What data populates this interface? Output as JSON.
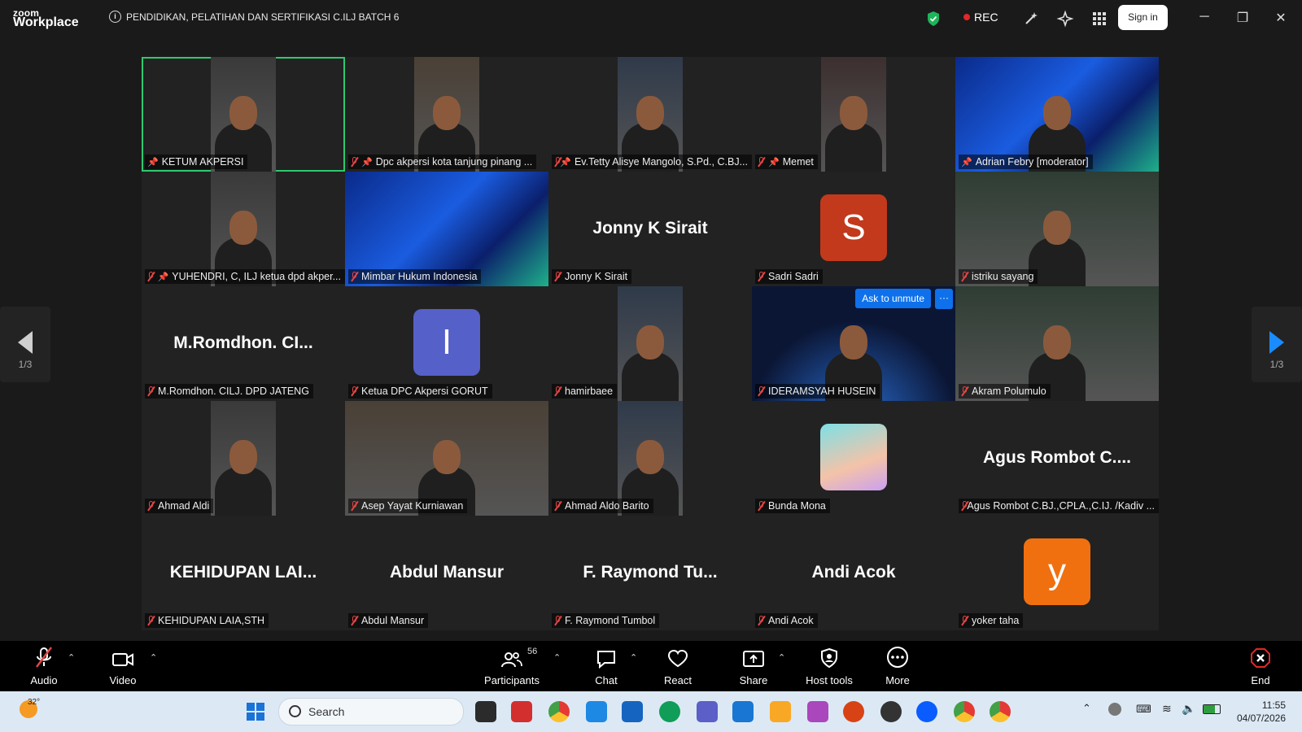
{
  "app": {
    "brand_top": "zoom",
    "brand_bottom": "Workplace",
    "meeting_title": "PENDIDIKAN, PELATIHAN DAN SERTIFIKASI C.ILJ BATCH 6",
    "rec_label": "REC",
    "sign_in": "Sign in"
  },
  "grid": {
    "tiles": [
      {
        "name": "KETUM AKPERSI",
        "muted": false,
        "pinned": true,
        "kind": "video",
        "active": true
      },
      {
        "name": "Dpc akpersi kota tanjung pinang ...",
        "muted": true,
        "pinned": true,
        "kind": "video"
      },
      {
        "name": "Ev.Tetty Alisye Mangolo, S.Pd., C.BJ...",
        "muted": true,
        "pinned": true,
        "kind": "video"
      },
      {
        "name": "Memet",
        "muted": true,
        "pinned": true,
        "kind": "video"
      },
      {
        "name": "Adrian Febry [moderator]",
        "muted": false,
        "pinned": true,
        "kind": "video-wide"
      },
      {
        "name": "YUHENDRI, C, ILJ ketua dpd akper...",
        "muted": true,
        "pinned": true,
        "kind": "video"
      },
      {
        "name": "Mimbar Hukum Indonesia",
        "muted": true,
        "pinned": false,
        "kind": "video-wide"
      },
      {
        "name": "Jonny K Sirait",
        "muted": true,
        "pinned": false,
        "kind": "text",
        "big": "Jonny K Sirait"
      },
      {
        "name": "Sadri Sadri",
        "muted": true,
        "pinned": false,
        "kind": "avatar",
        "letter": "S",
        "color": "#c2391b"
      },
      {
        "name": "istriku sayang",
        "muted": true,
        "pinned": false,
        "kind": "video-wide"
      },
      {
        "name": "M.Romdhon. CILJ. DPD JATENG",
        "muted": true,
        "pinned": false,
        "kind": "text",
        "big": "M.Romdhon. CI..."
      },
      {
        "name": "Ketua DPC Akpersi GORUT",
        "muted": true,
        "pinned": false,
        "kind": "avatar",
        "letter": "I",
        "color": "#5660c9"
      },
      {
        "name": "hamirbaee",
        "muted": true,
        "pinned": false,
        "kind": "video"
      },
      {
        "name": "IDERAMSYAH HUSEIN",
        "muted": true,
        "pinned": false,
        "kind": "video-wide",
        "ask_unmute": "Ask to unmute"
      },
      {
        "name": "Akram Polumulo",
        "muted": true,
        "pinned": false,
        "kind": "video-wide"
      },
      {
        "name": "Ahmad Aldi",
        "muted": true,
        "pinned": false,
        "kind": "video"
      },
      {
        "name": "Asep Yayat Kurniawan",
        "muted": true,
        "pinned": false,
        "kind": "video-wide"
      },
      {
        "name": "Ahmad Aldo Barito",
        "muted": true,
        "pinned": false,
        "kind": "video"
      },
      {
        "name": "Bunda Mona",
        "muted": true,
        "pinned": false,
        "kind": "photo"
      },
      {
        "name": "Agus Rombot C.BJ.,CPLA.,C.IJ. /Kadiv ...",
        "muted": true,
        "pinned": false,
        "kind": "text",
        "big": "Agus  Rombot  C...."
      },
      {
        "name": "KEHIDUPAN LAIA,STH",
        "muted": true,
        "pinned": false,
        "kind": "text",
        "big": "KEHIDUPAN  LAI..."
      },
      {
        "name": "Abdul Mansur",
        "muted": true,
        "pinned": false,
        "kind": "text",
        "big": "Abdul Mansur"
      },
      {
        "name": "F. Raymond Tumbol",
        "muted": true,
        "pinned": false,
        "kind": "text",
        "big": "F.  Raymond  Tu..."
      },
      {
        "name": "Andi Acok",
        "muted": true,
        "pinned": false,
        "kind": "text",
        "big": "Andi Acok"
      },
      {
        "name": "yoker taha",
        "muted": true,
        "pinned": false,
        "kind": "avatar",
        "letter": "y",
        "color": "#f07010"
      }
    ]
  },
  "pager": {
    "left": "1/3",
    "right": "1/3"
  },
  "toolbar": {
    "audio": "Audio",
    "video": "Video",
    "participants": "Participants",
    "participants_count": "56",
    "chat": "Chat",
    "react": "React",
    "share": "Share",
    "host_tools": "Host tools",
    "more": "More",
    "end": "End"
  },
  "taskbar": {
    "temp": "32°",
    "search": "Search",
    "time": "11:55",
    "date": "04/07/2026"
  },
  "colors": {
    "active_border": "#2ec96e",
    "end_red": "#e02828",
    "accent_blue": "#0e71eb"
  }
}
